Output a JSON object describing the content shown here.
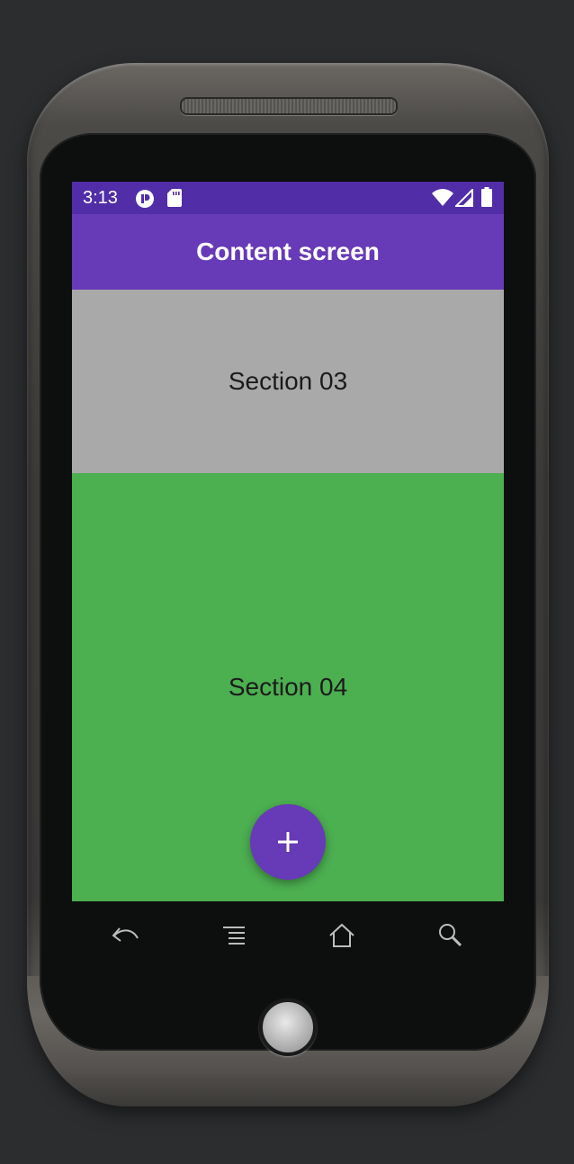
{
  "status_bar": {
    "time": "3:13",
    "left_icons": [
      "app-notification-icon",
      "sd-card-icon"
    ],
    "right_icons": [
      "wifi-icon",
      "cell-signal-icon",
      "battery-icon"
    ]
  },
  "app_bar": {
    "title": "Content screen"
  },
  "sections": [
    {
      "label": "Section 03",
      "color": "#a9a9a9"
    },
    {
      "label": "Section 04",
      "color": "#4caf50"
    }
  ],
  "fab": {
    "icon": "plus-icon",
    "color": "#673ab7"
  },
  "device_nav": {
    "buttons": [
      "back-icon",
      "menu-icon",
      "home-icon",
      "search-icon"
    ]
  },
  "colors": {
    "primary": "#673ab7",
    "primary_dark": "#512da8"
  }
}
